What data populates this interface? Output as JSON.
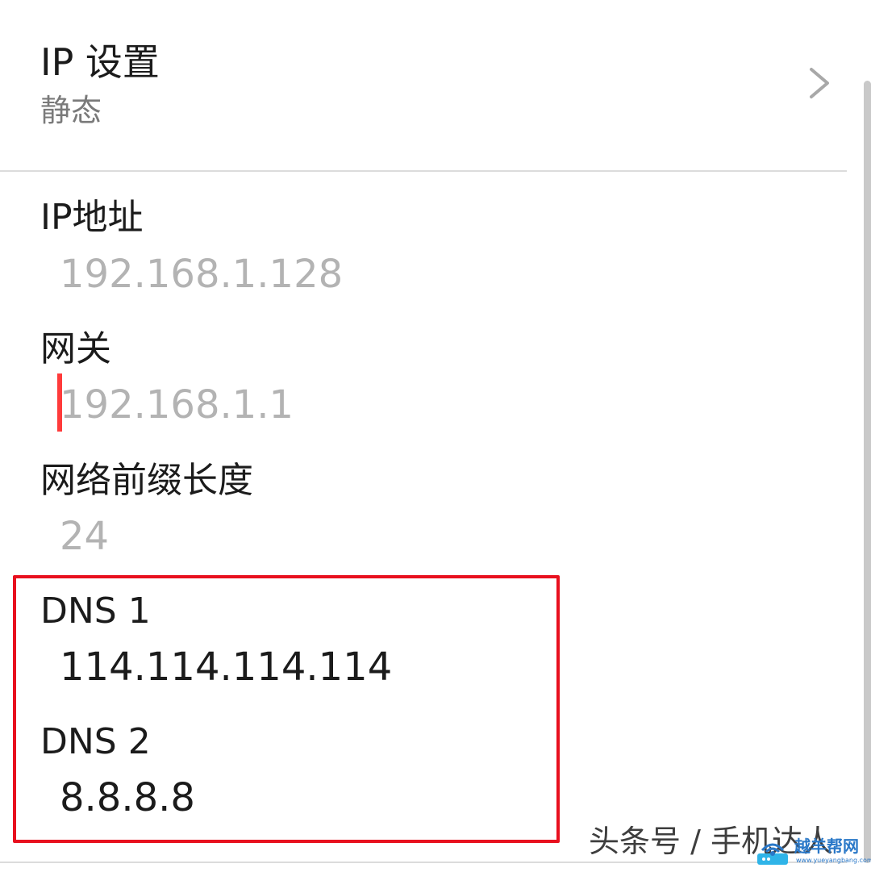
{
  "ip_settings": {
    "title": "IP 设置",
    "value": "静态",
    "chevron_icon": "chevron-right-icon"
  },
  "fields": {
    "ip_address": {
      "label": "IP地址",
      "value": "",
      "placeholder": "192.168.1.128"
    },
    "gateway": {
      "label": "网关",
      "value": "",
      "placeholder": "192.168.1.1"
    },
    "prefix_length": {
      "label": "网络前缀长度",
      "value": "",
      "placeholder": "24"
    },
    "dns1": {
      "label": "DNS 1",
      "value": "114.114.114.114"
    },
    "dns2": {
      "label": "DNS 2",
      "value": "8.8.8.8"
    }
  },
  "annotation": {
    "highlight_color": "#e8101e"
  },
  "watermark": {
    "text": "头条号 / 手机达人",
    "logo_title": "越羊帮网",
    "logo_url": "www.yueyangbang.com"
  },
  "colors": {
    "accent_cursor": "#ff3b3b",
    "primary_text": "#1b1b1b",
    "secondary_text": "#7a7a7a",
    "hint_text": "#b3b3b3"
  }
}
